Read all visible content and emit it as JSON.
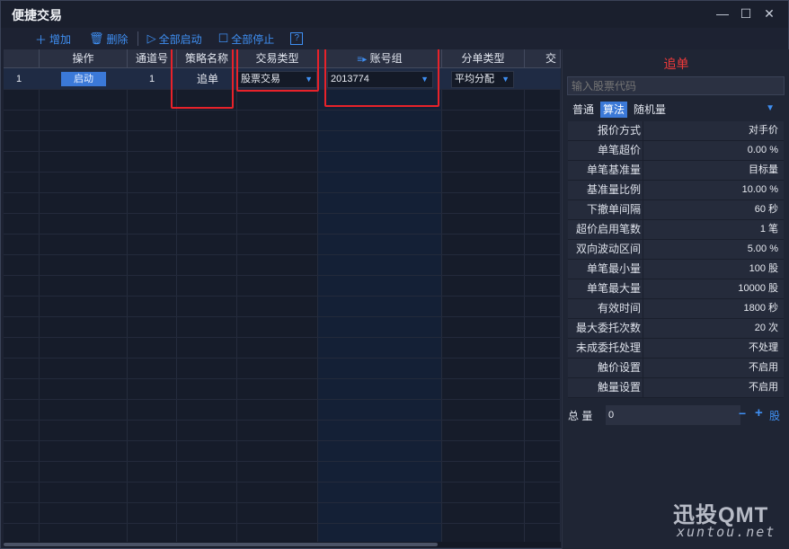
{
  "window": {
    "title": "便捷交易",
    "minimize": "—",
    "maximize": "☐",
    "close": "✕"
  },
  "toolbar": {
    "add_label": "增加",
    "delete_label": "删除",
    "start_all_label": "全部启动",
    "stop_all_label": "全部停止",
    "help_label": "?"
  },
  "table": {
    "headers": [
      "操作",
      "通道号",
      "策略名称",
      "交易类型",
      "账号组",
      "分单类型",
      "交"
    ],
    "rows": [
      {
        "index": "1",
        "action": "启动",
        "channel": "1",
        "strategy": "追单",
        "trade_type": "股票交易",
        "account_group": "2013774",
        "split_type": "平均分配"
      }
    ]
  },
  "panel": {
    "title": "追单",
    "code_placeholder": "输入股票代码",
    "tabs": [
      "普通",
      "算法",
      "随机量"
    ],
    "active_tab": "算法",
    "params": [
      {
        "label": "报价方式",
        "value": "对手价"
      },
      {
        "label": "单笔超价",
        "value": "0.00 %"
      },
      {
        "label": "单笔基准量",
        "value": "目标量"
      },
      {
        "label": "基准量比例",
        "value": "10.00 %"
      },
      {
        "label": "下撤单间隔",
        "value": "60 秒"
      },
      {
        "label": "超价启用笔数",
        "value": "1 笔"
      },
      {
        "label": "双向波动区间",
        "value": "5.00 %"
      },
      {
        "label": "单笔最小量",
        "value": "100 股"
      },
      {
        "label": "单笔最大量",
        "value": "10000 股"
      },
      {
        "label": "有效时间",
        "value": "1800 秒"
      },
      {
        "label": "最大委托次数",
        "value": "20 次"
      },
      {
        "label": "未成委托处理",
        "value": "不处理"
      },
      {
        "label": "触价设置",
        "value": "不启用"
      },
      {
        "label": "触量设置",
        "value": "不启用"
      }
    ],
    "total_label": "总 量",
    "total_value": "0",
    "total_unit": "股"
  },
  "watermark": {
    "brand": "迅投QMT",
    "site": "xuntou.net"
  },
  "colors": {
    "accent": "#3f8ff2",
    "highlight_red": "#e8222a",
    "background": "#1d2232"
  }
}
